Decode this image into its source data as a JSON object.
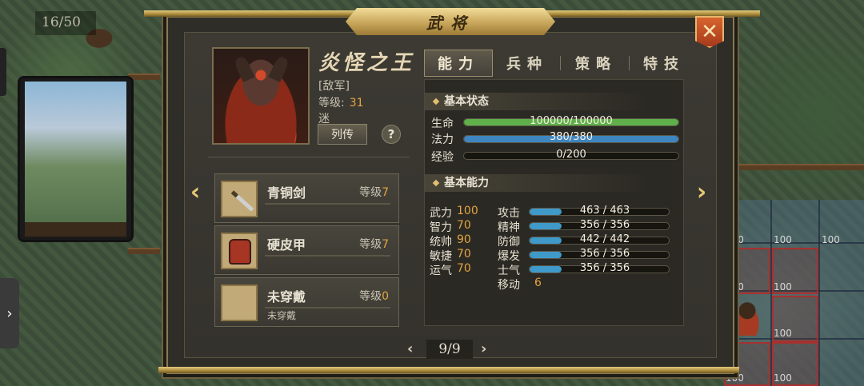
{
  "turn_counter": "16/50",
  "window": {
    "title": "武将"
  },
  "hero": {
    "name": "炎怪之王",
    "faction": "[敌军]",
    "level_label": "等级:",
    "level_value": "31",
    "status": "迷",
    "bio_button": "列传",
    "help_button": "?"
  },
  "equipment": [
    {
      "name": "青铜剑",
      "level_label": "等级",
      "level": "7",
      "icon": "sword-icon",
      "sub": ""
    },
    {
      "name": "硬皮甲",
      "level_label": "等级",
      "level": "7",
      "icon": "armor-icon",
      "sub": ""
    },
    {
      "name": "未穿戴",
      "level_label": "等级",
      "level": "0",
      "icon": "empty-slot",
      "sub": "未穿戴"
    }
  ],
  "tabs": [
    "能力",
    "兵种",
    "策略",
    "特技"
  ],
  "basic_status": {
    "title": "基本状态",
    "hp": {
      "label": "生命",
      "text": "100000/100000",
      "fraction": 1.0,
      "color": "#5fb04a"
    },
    "mp": {
      "label": "法力",
      "text": "380/380",
      "fraction": 1.0,
      "color": "#3f86c0"
    },
    "exp": {
      "label": "经验",
      "text": "0/200",
      "fraction": 0.0,
      "color": "#3f86c0"
    }
  },
  "basic_abilities": {
    "title": "基本能力",
    "attributes": [
      {
        "label": "武力",
        "value": "100"
      },
      {
        "label": "智力",
        "value": "70"
      },
      {
        "label": "统帅",
        "value": "90"
      },
      {
        "label": "敏捷",
        "value": "70"
      },
      {
        "label": "运气",
        "value": "70"
      }
    ],
    "combat": [
      {
        "label": "攻击",
        "text": "463 / 463",
        "fraction": 1.0
      },
      {
        "label": "精神",
        "text": "356 / 356",
        "fraction": 1.0
      },
      {
        "label": "防御",
        "text": "442 / 442",
        "fraction": 1.0
      },
      {
        "label": "爆发",
        "text": "356 / 356",
        "fraction": 1.0
      },
      {
        "label": "士气",
        "text": "356 / 356",
        "fraction": 1.0
      }
    ],
    "move_label": "移动",
    "move_value": "6"
  },
  "pager": {
    "text": "9/9",
    "prev": "‹",
    "next": "›"
  },
  "map_grid_labels": [
    "100",
    "100",
    "100",
    "100",
    "100",
    "100",
    "100",
    "100"
  ],
  "colors": {
    "accent_gold": "#e2c071",
    "level_orange": "#e2a541",
    "close_red": "#c24b24"
  }
}
